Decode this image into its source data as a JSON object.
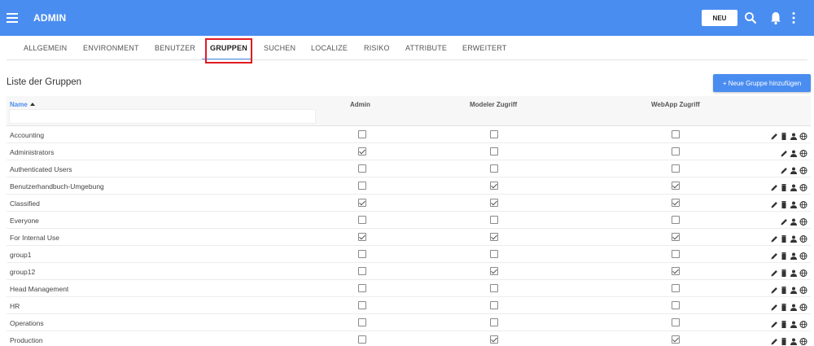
{
  "header": {
    "title": "ADMIN",
    "new_label": "NEU",
    "color": "#4a8df0"
  },
  "tabs": [
    {
      "label": "ALLGEMEIN"
    },
    {
      "label": "ENVIRONMENT"
    },
    {
      "label": "BENUTZER"
    },
    {
      "label": "GRUPPEN",
      "active": true
    },
    {
      "label": "SUCHEN"
    },
    {
      "label": "LOCALIZE"
    },
    {
      "label": "RISIKO"
    },
    {
      "label": "ATTRIBUTE"
    },
    {
      "label": "ERWEITERT"
    }
  ],
  "list": {
    "title": "Liste der Gruppen",
    "add_label": "+ Neue Gruppe hinzufügen"
  },
  "table": {
    "columns": {
      "name": "Name",
      "admin": "Admin",
      "modeler": "Modeler Zugriff",
      "webapp": "WebApp Zugriff"
    },
    "filter_value": "",
    "rows": [
      {
        "name": "Accounting",
        "admin": false,
        "modeler": false,
        "webapp": false,
        "actions": [
          "edit-icon",
          "delete-icon",
          "users-icon",
          "globe-icon"
        ]
      },
      {
        "name": "Administrators",
        "admin": true,
        "modeler": false,
        "webapp": false,
        "actions": [
          "edit-icon",
          "users-icon",
          "globe-icon"
        ]
      },
      {
        "name": "Authenticated Users",
        "admin": false,
        "modeler": false,
        "webapp": false,
        "actions": [
          "edit-icon",
          "users-icon",
          "globe-icon"
        ]
      },
      {
        "name": "Benutzerhandbuch-Umgebung",
        "admin": false,
        "modeler": true,
        "webapp": true,
        "actions": [
          "edit-icon",
          "delete-icon",
          "users-icon",
          "globe-icon"
        ]
      },
      {
        "name": "Classified",
        "admin": true,
        "modeler": true,
        "webapp": true,
        "actions": [
          "edit-icon",
          "delete-icon",
          "users-icon",
          "globe-icon"
        ]
      },
      {
        "name": "Everyone",
        "admin": false,
        "modeler": false,
        "webapp": false,
        "actions": [
          "edit-icon",
          "users-icon",
          "globe-icon"
        ]
      },
      {
        "name": "For Internal Use",
        "admin": true,
        "modeler": true,
        "webapp": true,
        "actions": [
          "edit-icon",
          "delete-icon",
          "users-icon",
          "globe-icon"
        ]
      },
      {
        "name": "group1",
        "admin": false,
        "modeler": false,
        "webapp": false,
        "actions": [
          "edit-icon",
          "delete-icon",
          "users-icon",
          "globe-icon"
        ]
      },
      {
        "name": "group12",
        "admin": false,
        "modeler": true,
        "webapp": true,
        "actions": [
          "edit-icon",
          "delete-icon",
          "users-icon",
          "globe-icon"
        ]
      },
      {
        "name": "Head Management",
        "admin": false,
        "modeler": false,
        "webapp": false,
        "actions": [
          "edit-icon",
          "delete-icon",
          "users-icon",
          "globe-icon"
        ]
      },
      {
        "name": "HR",
        "admin": false,
        "modeler": false,
        "webapp": false,
        "actions": [
          "edit-icon",
          "delete-icon",
          "users-icon",
          "globe-icon"
        ]
      },
      {
        "name": "Operations",
        "admin": false,
        "modeler": false,
        "webapp": false,
        "actions": [
          "edit-icon",
          "delete-icon",
          "users-icon",
          "globe-icon"
        ]
      },
      {
        "name": "Production",
        "admin": false,
        "modeler": true,
        "webapp": true,
        "actions": [
          "edit-icon",
          "delete-icon",
          "users-icon",
          "globe-icon"
        ]
      }
    ]
  }
}
